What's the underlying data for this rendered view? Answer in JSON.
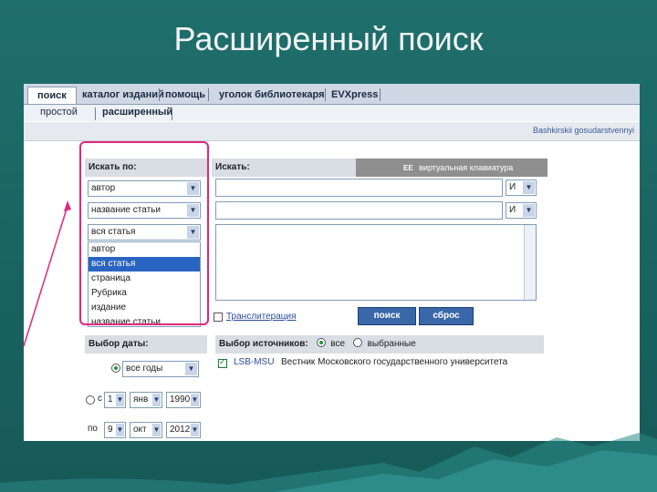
{
  "slide": {
    "title": "Расширенный поиск"
  },
  "colors": {
    "accent": "#e0287a",
    "selection": "#2a64c2",
    "button": "#3a67a8"
  },
  "nav": {
    "tabs": [
      "поиск",
      "каталог изданий",
      "помощь",
      "уголок библиотекаря",
      "EVXpress"
    ],
    "subtabs": [
      "простой",
      "расширенный"
    ],
    "info_link": "Bashkirskii gosudarstvennyi"
  },
  "search_in": {
    "header": "Искать по:",
    "selects": [
      "автор",
      "название статьи",
      "вся статья"
    ],
    "list_options": [
      "автор",
      "вся статья",
      "страница",
      "Рубрика",
      "издание",
      "название статьи"
    ],
    "selected_option": "вся статья"
  },
  "search_for": {
    "header": "Искать:",
    "keyboard_label": "виртуальная клавиатура",
    "keyboard_icon": "EE",
    "bool_ops": [
      "И",
      "И"
    ]
  },
  "options": {
    "transliteration": "Транслитерация",
    "search_button": "поиск",
    "reset_button": "сброс"
  },
  "date": {
    "header": "Выбор даты:",
    "all_years": "все годы",
    "from_label": "с",
    "from_day": "1",
    "from_month": "янв",
    "from_year": "1990",
    "to_label": "по",
    "to_day": "9",
    "to_month": "окт",
    "to_year": "2012"
  },
  "sources": {
    "header": "Выбор источников:",
    "all_label": "все",
    "selected_label": "выбранные",
    "items": [
      {
        "code": "LSB-MSU",
        "name": "Вестник Московского государственного университета"
      }
    ]
  }
}
